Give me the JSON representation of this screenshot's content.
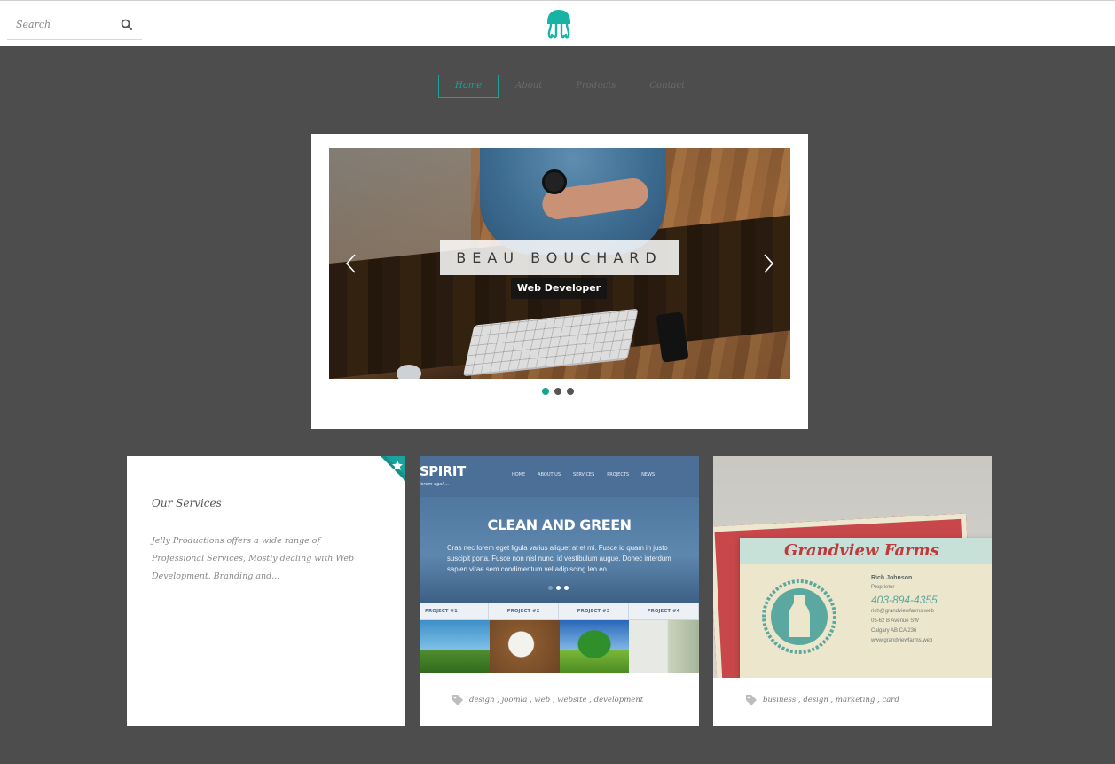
{
  "header": {
    "search_placeholder": "Search",
    "search_icon": "search-icon",
    "logo_icon": "jellyfish-logo-icon",
    "brand_color": "#19a39a"
  },
  "nav": {
    "items": [
      {
        "label": "Home",
        "active": true
      },
      {
        "label": "About",
        "active": false
      },
      {
        "label": "Products",
        "active": false
      },
      {
        "label": "Contact",
        "active": false
      }
    ]
  },
  "slider": {
    "title": "BEAU BOUCHARD",
    "subtitle": "Web Developer",
    "prev_icon": "chevron-left-icon",
    "next_icon": "chevron-right-icon",
    "slide_count": 3,
    "active_index": 0,
    "active_dot_color": "#19a38e"
  },
  "services": {
    "title": "Our Services",
    "text": "Jelly Productions offers a wide range of Professional Services, Mostly dealing with Web Development, Branding and...",
    "ribbon_icon": "star-icon"
  },
  "portfolio": [
    {
      "thumbnail": {
        "logo": "SPIRIT",
        "tagline": "lorem egal ...",
        "menu": [
          "HOME",
          "ABOUT US",
          "SERVICES",
          "PROJECTS",
          "NEWS"
        ],
        "hero_title": "CLEAN AND GREEN",
        "hero_text": "Cras nec lorem eget ligula varius aliquet at et mi. Fusce id quam in justo suscipit porta. Fusce non nisl nunc, id vestibulum augue. Donec interdum sapien vitae sem condimentum vel adipiscing leo eo.",
        "projects": [
          "PROJECT #1",
          "PROJECT #2",
          "PROJECT #3",
          "PROJECT #4"
        ]
      },
      "tags": [
        "design",
        "joomla",
        "web",
        "website",
        "development"
      ],
      "tag_icon": "tag-icon"
    },
    {
      "thumbnail": {
        "brand": "Grandview Farms",
        "person": "Rich Johnson",
        "role": "Proprietor",
        "phone": "403-894-4355",
        "email": "rich@grandviewfarms.web",
        "address1": "05-62 B Avenue SW",
        "address2": "Calgary AB CA 236",
        "website": "www.grandviewfarms.web"
      },
      "tags": [
        "business",
        "design",
        "marketing",
        "card"
      ],
      "tag_icon": "tag-icon"
    }
  ]
}
